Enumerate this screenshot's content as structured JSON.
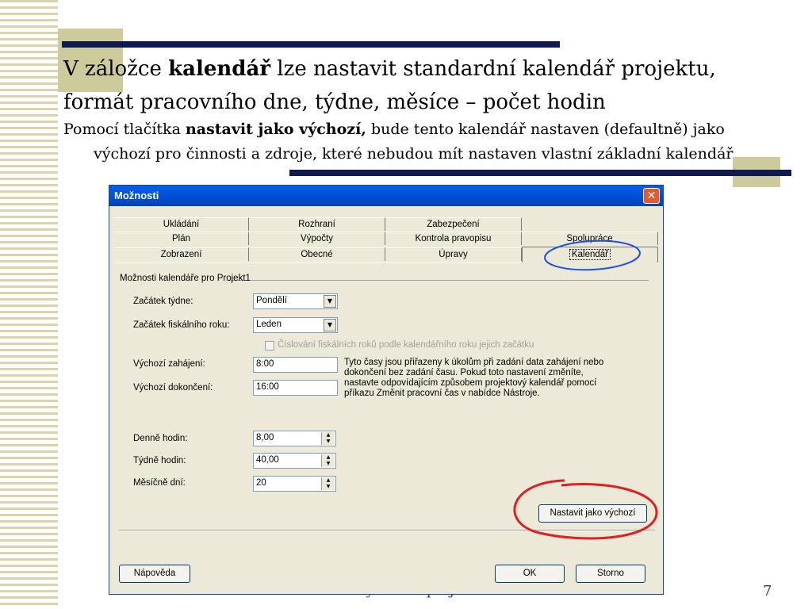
{
  "slide": {
    "heading_line1_pre": "V záložce ",
    "heading_line1_bold": "kalendář",
    "heading_line1_post": " lze nastavit standardní kalendář projektu,",
    "heading_line2": "formát pracovního dne, týdne, měsíce – počet hodin",
    "body_line1_pre": "Pomocí tlačítka ",
    "body_line1_bold": "nastavit jako výchozí,",
    "body_line1_post": " bude tento kalendář nastaven (defaultně) jako",
    "body_line2": "výchozí pro činnosti a zdroje, které nebudou mít nastaven vlastní základní kalendář",
    "footer": "Vytvoření projektu",
    "page_number": "7"
  },
  "dialog": {
    "title": "Možnosti",
    "close_symbol": "✕",
    "tabs_row1": [
      "Ukládání",
      "Rozhraní",
      "Zabezpečení"
    ],
    "tabs_row2": [
      "Plán",
      "Výpočty",
      "Kontrola pravopisu",
      "Spolupráce"
    ],
    "tabs_row3": [
      "Zobrazení",
      "Obecné",
      "Úpravy"
    ],
    "active_tab": "Kalendář",
    "group_label": "Možnosti kalendáře pro Projekt1",
    "week_start_label": "Začátek týdne:",
    "week_start_value": "Pondělí",
    "fiscal_start_label": "Začátek fiskálního roku:",
    "fiscal_start_value": "Leden",
    "fiscal_checkbox_label": "Číslování fiskálních roků podle kalendářního roku jejich začátku",
    "default_start_label": "Výchozí zahájení:",
    "default_start_value": "8:00",
    "default_end_label": "Výchozí dokončení:",
    "default_end_value": "16:00",
    "info_text": [
      "Tyto časy jsou přiřazeny k úkolům při zadání data zahájení nebo",
      "dokončení bez zadání času. Pokud toto nastavení změníte,",
      "nastavte odpovídajícím způsobem projektový kalendář pomocí",
      "příkazu Změnit pracovní čas v nabídce Nástroje."
    ],
    "hours_day_label": "Denně hodin:",
    "hours_day_value": "8,00",
    "hours_week_label": "Týdně hodin:",
    "hours_week_value": "40,00",
    "days_month_label": "Měsíčně dní:",
    "days_month_value": "20",
    "set_default_button": "Nastavit jako výchozí",
    "help_button": "Nápověda",
    "ok_button": "OK",
    "cancel_button": "Storno",
    "drop_symbol": "▼",
    "spin_up": "▲",
    "spin_down": "▼"
  },
  "colors": {
    "title_blue": "#101a4f",
    "accent_olive": "#cdcb9b",
    "annotation_red": "#e02020",
    "annotation_blue": "#2050e0"
  }
}
